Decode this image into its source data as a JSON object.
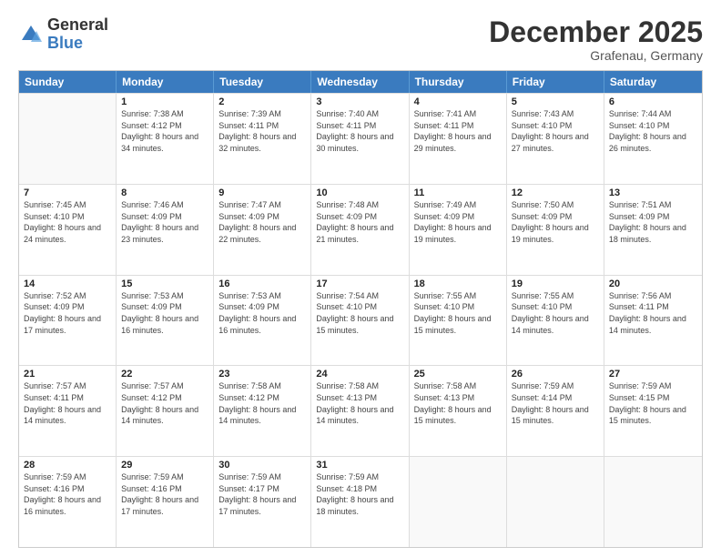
{
  "header": {
    "logo_general": "General",
    "logo_blue": "Blue",
    "month_title": "December 2025",
    "subtitle": "Grafenau, Germany"
  },
  "days_of_week": [
    "Sunday",
    "Monday",
    "Tuesday",
    "Wednesday",
    "Thursday",
    "Friday",
    "Saturday"
  ],
  "weeks": [
    [
      {
        "day": "",
        "sunrise": "",
        "sunset": "",
        "daylight": ""
      },
      {
        "day": "1",
        "sunrise": "Sunrise: 7:38 AM",
        "sunset": "Sunset: 4:12 PM",
        "daylight": "Daylight: 8 hours and 34 minutes."
      },
      {
        "day": "2",
        "sunrise": "Sunrise: 7:39 AM",
        "sunset": "Sunset: 4:11 PM",
        "daylight": "Daylight: 8 hours and 32 minutes."
      },
      {
        "day": "3",
        "sunrise": "Sunrise: 7:40 AM",
        "sunset": "Sunset: 4:11 PM",
        "daylight": "Daylight: 8 hours and 30 minutes."
      },
      {
        "day": "4",
        "sunrise": "Sunrise: 7:41 AM",
        "sunset": "Sunset: 4:11 PM",
        "daylight": "Daylight: 8 hours and 29 minutes."
      },
      {
        "day": "5",
        "sunrise": "Sunrise: 7:43 AM",
        "sunset": "Sunset: 4:10 PM",
        "daylight": "Daylight: 8 hours and 27 minutes."
      },
      {
        "day": "6",
        "sunrise": "Sunrise: 7:44 AM",
        "sunset": "Sunset: 4:10 PM",
        "daylight": "Daylight: 8 hours and 26 minutes."
      }
    ],
    [
      {
        "day": "7",
        "sunrise": "Sunrise: 7:45 AM",
        "sunset": "Sunset: 4:10 PM",
        "daylight": "Daylight: 8 hours and 24 minutes."
      },
      {
        "day": "8",
        "sunrise": "Sunrise: 7:46 AM",
        "sunset": "Sunset: 4:09 PM",
        "daylight": "Daylight: 8 hours and 23 minutes."
      },
      {
        "day": "9",
        "sunrise": "Sunrise: 7:47 AM",
        "sunset": "Sunset: 4:09 PM",
        "daylight": "Daylight: 8 hours and 22 minutes."
      },
      {
        "day": "10",
        "sunrise": "Sunrise: 7:48 AM",
        "sunset": "Sunset: 4:09 PM",
        "daylight": "Daylight: 8 hours and 21 minutes."
      },
      {
        "day": "11",
        "sunrise": "Sunrise: 7:49 AM",
        "sunset": "Sunset: 4:09 PM",
        "daylight": "Daylight: 8 hours and 19 minutes."
      },
      {
        "day": "12",
        "sunrise": "Sunrise: 7:50 AM",
        "sunset": "Sunset: 4:09 PM",
        "daylight": "Daylight: 8 hours and 19 minutes."
      },
      {
        "day": "13",
        "sunrise": "Sunrise: 7:51 AM",
        "sunset": "Sunset: 4:09 PM",
        "daylight": "Daylight: 8 hours and 18 minutes."
      }
    ],
    [
      {
        "day": "14",
        "sunrise": "Sunrise: 7:52 AM",
        "sunset": "Sunset: 4:09 PM",
        "daylight": "Daylight: 8 hours and 17 minutes."
      },
      {
        "day": "15",
        "sunrise": "Sunrise: 7:53 AM",
        "sunset": "Sunset: 4:09 PM",
        "daylight": "Daylight: 8 hours and 16 minutes."
      },
      {
        "day": "16",
        "sunrise": "Sunrise: 7:53 AM",
        "sunset": "Sunset: 4:09 PM",
        "daylight": "Daylight: 8 hours and 16 minutes."
      },
      {
        "day": "17",
        "sunrise": "Sunrise: 7:54 AM",
        "sunset": "Sunset: 4:10 PM",
        "daylight": "Daylight: 8 hours and 15 minutes."
      },
      {
        "day": "18",
        "sunrise": "Sunrise: 7:55 AM",
        "sunset": "Sunset: 4:10 PM",
        "daylight": "Daylight: 8 hours and 15 minutes."
      },
      {
        "day": "19",
        "sunrise": "Sunrise: 7:55 AM",
        "sunset": "Sunset: 4:10 PM",
        "daylight": "Daylight: 8 hours and 14 minutes."
      },
      {
        "day": "20",
        "sunrise": "Sunrise: 7:56 AM",
        "sunset": "Sunset: 4:11 PM",
        "daylight": "Daylight: 8 hours and 14 minutes."
      }
    ],
    [
      {
        "day": "21",
        "sunrise": "Sunrise: 7:57 AM",
        "sunset": "Sunset: 4:11 PM",
        "daylight": "Daylight: 8 hours and 14 minutes."
      },
      {
        "day": "22",
        "sunrise": "Sunrise: 7:57 AM",
        "sunset": "Sunset: 4:12 PM",
        "daylight": "Daylight: 8 hours and 14 minutes."
      },
      {
        "day": "23",
        "sunrise": "Sunrise: 7:58 AM",
        "sunset": "Sunset: 4:12 PM",
        "daylight": "Daylight: 8 hours and 14 minutes."
      },
      {
        "day": "24",
        "sunrise": "Sunrise: 7:58 AM",
        "sunset": "Sunset: 4:13 PM",
        "daylight": "Daylight: 8 hours and 14 minutes."
      },
      {
        "day": "25",
        "sunrise": "Sunrise: 7:58 AM",
        "sunset": "Sunset: 4:13 PM",
        "daylight": "Daylight: 8 hours and 15 minutes."
      },
      {
        "day": "26",
        "sunrise": "Sunrise: 7:59 AM",
        "sunset": "Sunset: 4:14 PM",
        "daylight": "Daylight: 8 hours and 15 minutes."
      },
      {
        "day": "27",
        "sunrise": "Sunrise: 7:59 AM",
        "sunset": "Sunset: 4:15 PM",
        "daylight": "Daylight: 8 hours and 15 minutes."
      }
    ],
    [
      {
        "day": "28",
        "sunrise": "Sunrise: 7:59 AM",
        "sunset": "Sunset: 4:16 PM",
        "daylight": "Daylight: 8 hours and 16 minutes."
      },
      {
        "day": "29",
        "sunrise": "Sunrise: 7:59 AM",
        "sunset": "Sunset: 4:16 PM",
        "daylight": "Daylight: 8 hours and 17 minutes."
      },
      {
        "day": "30",
        "sunrise": "Sunrise: 7:59 AM",
        "sunset": "Sunset: 4:17 PM",
        "daylight": "Daylight: 8 hours and 17 minutes."
      },
      {
        "day": "31",
        "sunrise": "Sunrise: 7:59 AM",
        "sunset": "Sunset: 4:18 PM",
        "daylight": "Daylight: 8 hours and 18 minutes."
      },
      {
        "day": "",
        "sunrise": "",
        "sunset": "",
        "daylight": ""
      },
      {
        "day": "",
        "sunrise": "",
        "sunset": "",
        "daylight": ""
      },
      {
        "day": "",
        "sunrise": "",
        "sunset": "",
        "daylight": ""
      }
    ]
  ]
}
